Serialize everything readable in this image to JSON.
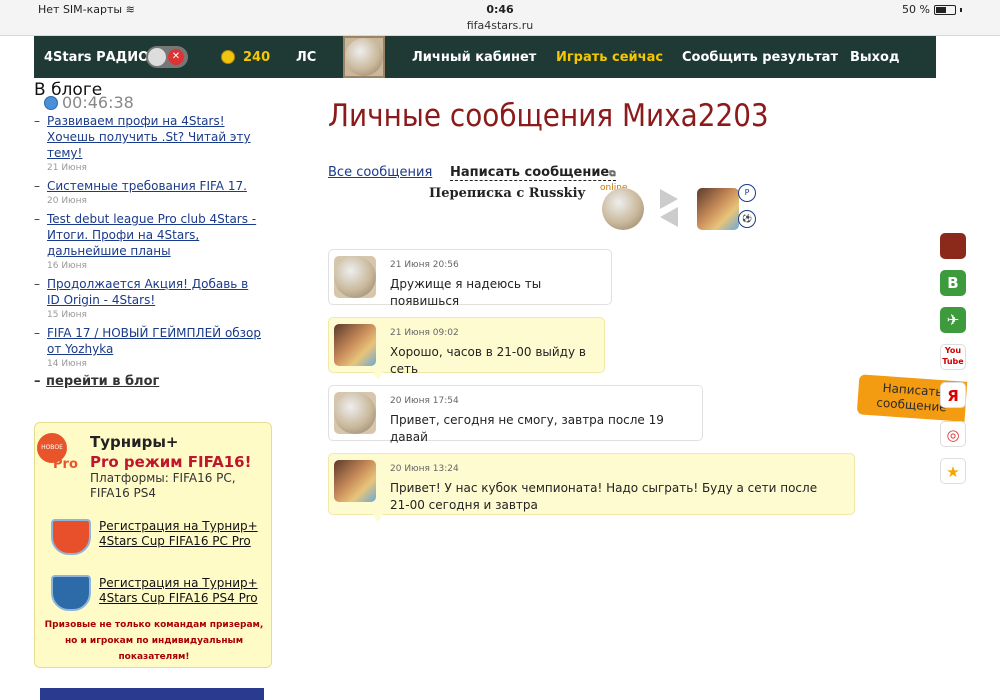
{
  "status": {
    "carrier": "Нет SIM-карты",
    "time": "0:46",
    "url": "fifa4stars.ru",
    "battery": "50 %"
  },
  "nav": {
    "radio": "4Stars РАДИО",
    "coins": "240",
    "ls": "ЛС",
    "cabinet": "Личный кабинет",
    "play": "Играть сейчас",
    "report": "Сообщить результат",
    "exit": "Выход",
    "accent": "#f3c800"
  },
  "sidebar": {
    "heading": "В блоге",
    "timer": "00:46:38",
    "items": [
      {
        "title": "Развиваем профи на 4Stars! Хочешь получить .St? Читай эту тему!",
        "date": "21 Июня"
      },
      {
        "title": "Системные требования FIFA 17.",
        "date": "20 Июня"
      },
      {
        "title": "Test debut league Pro club 4Stars - Итоги. Профи на 4Stars, дальнейшие планы",
        "date": "16 Июня"
      },
      {
        "title": "Продолжается Акция! Добавь в ID Origin - 4Stars!",
        "date": "15 Июня"
      },
      {
        "title": "FIFA 17 / НОВЫЙ ГЕЙМПЛЕЙ обзор от Yozhyka",
        "date": "14 Июня"
      }
    ],
    "more": "перейти в блог"
  },
  "tournament": {
    "badge_new": "НОВОЕ",
    "badge_pro": "Pro",
    "title": "Турниры+",
    "subtitle": "Pro режим FIFA16!",
    "platforms": "Платформы: FIFA16 PC, FIFA16 PS4",
    "reg_pc": "Регистрация на Турнир+ 4Stars Cup FIFA16 PC Pro",
    "reg_ps4": "Регистрация на Турнир+ 4Stars Cup FIFA16 PS4 Pro",
    "note": "Призовые не только командам призерам, но и игрокам по индивидуальным показателям!"
  },
  "main": {
    "title": "Личные сообщения Миха2203",
    "all_messages": "Все сообщения",
    "write_message": "Написать сообщение",
    "correspondence": "Переписка с Russkiy",
    "online": "online"
  },
  "messages": [
    {
      "direction": "in",
      "time": "21 Июня 20:56",
      "text": "Дружище я надеюсь ты появишься"
    },
    {
      "direction": "out",
      "time": "21 Июня 09:02",
      "text": "Хорошо, часов в 21-00 выйду в сеть"
    },
    {
      "direction": "in",
      "time": "20 Июня 17:54",
      "text": "Привет, сегодня не смогу, завтра после 19 давай"
    },
    {
      "direction": "out",
      "time": "20 Июня 13:24",
      "text": "Привет! У нас кубок чемпионата! Надо сыграть! Буду а сети после 21-00 сегодня и завтра"
    }
  ],
  "float": {
    "write": "Написать сообщение",
    "vk": "B",
    "yt": "You Tube",
    "ya": "Я"
  }
}
